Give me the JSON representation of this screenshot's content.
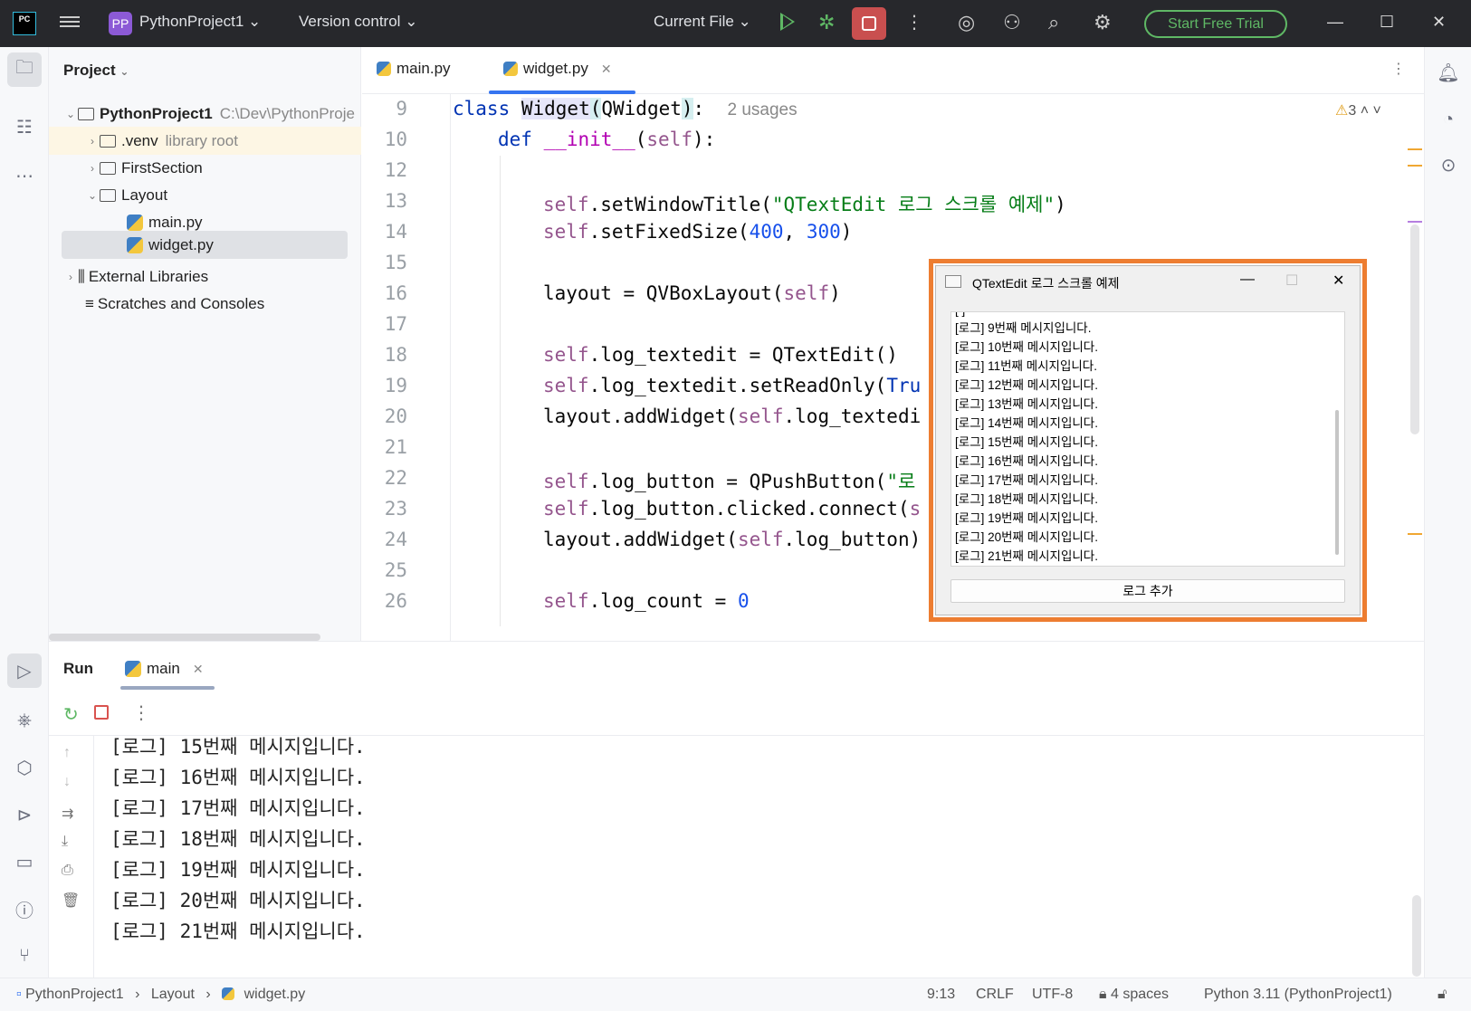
{
  "titlebar": {
    "project_badge": "PP",
    "project_name": "PythonProject1",
    "version_control": "Version control",
    "run_config": "Current File",
    "trial": "Start Free Trial"
  },
  "project_panel": {
    "header": "Project",
    "tree": [
      {
        "label": "PythonProject1",
        "hint": "C:\\Dev\\PythonProje"
      },
      {
        "label": ".venv",
        "hint": "library root"
      },
      {
        "label": "FirstSection",
        "hint": ""
      },
      {
        "label": "Layout",
        "hint": ""
      },
      {
        "label": "main.py",
        "hint": ""
      },
      {
        "label": "widget.py",
        "hint": ""
      },
      {
        "label": "External Libraries",
        "hint": ""
      },
      {
        "label": "Scratches and Consoles",
        "hint": ""
      }
    ]
  },
  "editor": {
    "tabs": [
      {
        "label": "main.py"
      },
      {
        "label": "widget.py"
      }
    ],
    "warning_count": "3",
    "line_numbers": [
      "9",
      "10",
      "12",
      "13",
      "14",
      "15",
      "16",
      "17",
      "18",
      "19",
      "20",
      "21",
      "22",
      "23",
      "24",
      "25",
      "26"
    ],
    "usages": "2 usages",
    "code": {
      "l9a": "class ",
      "l9b": "Widget",
      "l9c": "(",
      "l9d": "QWidget",
      "l9e": ")",
      "l9f": ":",
      "l10a": "def ",
      "l10b": "__init__",
      "l10c": "(",
      "l10d": "self",
      "l10e": "):",
      "l13a": "self",
      "l13b": ".setWindowTitle(",
      "l13c": "\"QTextEdit 로그 스크롤 예제\"",
      "l13d": ")",
      "l14a": "self",
      "l14b": ".setFixedSize(",
      "l14c": "400",
      "l14d": ", ",
      "l14e": "300",
      "l14f": ")",
      "l16a": "layout = QVBoxLayout(",
      "l16b": "self",
      "l16c": ")",
      "l18a": "self",
      "l18b": ".log_textedit = QTextEdit()",
      "l19a": "self",
      "l19b": ".log_textedit.setReadOnly(",
      "l19c": "Tru",
      "l20a": "layout.addWidget(",
      "l20b": "self",
      "l20c": ".log_textedi",
      "l22a": "self",
      "l22b": ".log_button = QPushButton(",
      "l22c": "\"로",
      "l23a": "self",
      "l23b": ".log_button.clicked.connect(",
      "l23c": "s",
      "l24a": "layout.addWidget(",
      "l24b": "self",
      "l24c": ".log_button)",
      "l26a": "self",
      "l26b": ".log_count = ",
      "l26c": "0"
    }
  },
  "qt_window": {
    "title": "QTextEdit 로그 스크롤 예제",
    "lines": [
      "[로그] 9번째 메시지입니다.",
      "[로그] 10번째 메시지입니다.",
      "[로그] 11번째 메시지입니다.",
      "[로그] 12번째 메시지입니다.",
      "[로그] 13번째 메시지입니다.",
      "[로그] 14번째 메시지입니다.",
      "[로그] 15번째 메시지입니다.",
      "[로그] 16번째 메시지입니다.",
      "[로그] 17번째 메시지입니다.",
      "[로그] 18번째 메시지입니다.",
      "[로그] 19번째 메시지입니다.",
      "[로그] 20번째 메시지입니다.",
      "[로그] 21번째 메시지입니다."
    ],
    "button": "로그 추가"
  },
  "run_panel": {
    "title": "Run",
    "tab": "main",
    "output": [
      "[로그] 15번째 메시지입니다.",
      "[로그] 16번째 메시지입니다.",
      "[로그] 17번째 메시지입니다.",
      "[로그] 18번째 메시지입니다.",
      "[로그] 19번째 메시지입니다.",
      "[로그] 20번째 메시지입니다.",
      "[로그] 21번째 메시지입니다."
    ]
  },
  "statusbar": {
    "crumb_project": "PythonProject1",
    "crumb_folder": "Layout",
    "crumb_file": "widget.py",
    "position": "9:13",
    "line_sep": "CRLF",
    "encoding": "UTF-8",
    "indent": "4 spaces",
    "interpreter": "Python 3.11 (PythonProject1)"
  },
  "colors": {
    "accent": "#3574f0",
    "highlight_box": "#ed7d31",
    "run_green": "#5fb865",
    "stop_red": "#c94f4f"
  }
}
